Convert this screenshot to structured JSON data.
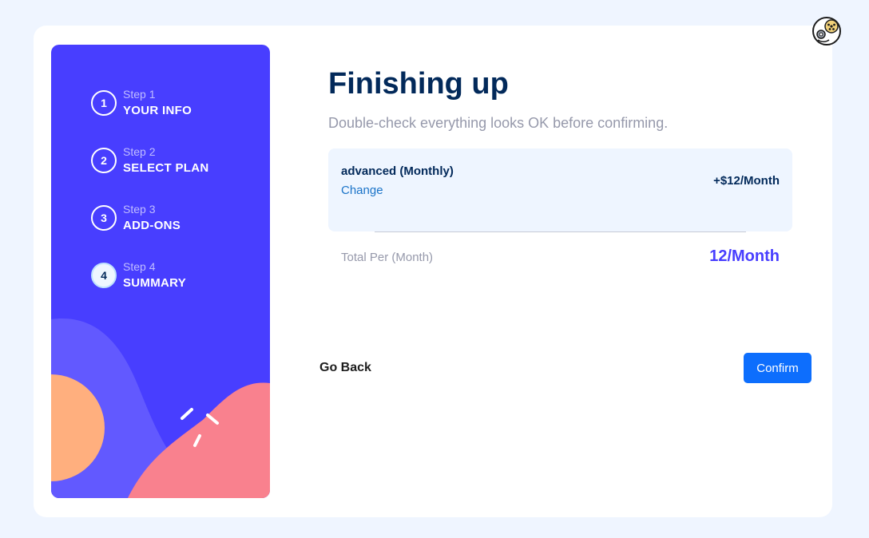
{
  "steps": [
    {
      "number": "1",
      "label": "Step 1",
      "title": "YOUR INFO"
    },
    {
      "number": "2",
      "label": "Step 2",
      "title": "SELECT PLAN"
    },
    {
      "number": "3",
      "label": "Step 3",
      "title": "ADD-ONS"
    },
    {
      "number": "4",
      "label": "Step 4",
      "title": "SUMMARY"
    }
  ],
  "active_step": 4,
  "main": {
    "heading": "Finishing up",
    "subheading": "Double-check everything looks OK before confirming."
  },
  "summary": {
    "plan_name": "advanced (Monthly)",
    "change_label": "Change",
    "plan_price": "+$12/Month",
    "total_label": "Total Per (Month)",
    "total_value": "12/Month"
  },
  "actions": {
    "back_label": "Go Back",
    "confirm_label": "Confirm"
  },
  "icons": {
    "corner": "film-reel-icon"
  },
  "colors": {
    "sidebar": "#483eff",
    "heading": "#02295a",
    "accent": "#483eff",
    "confirm": "#0d6efd"
  }
}
